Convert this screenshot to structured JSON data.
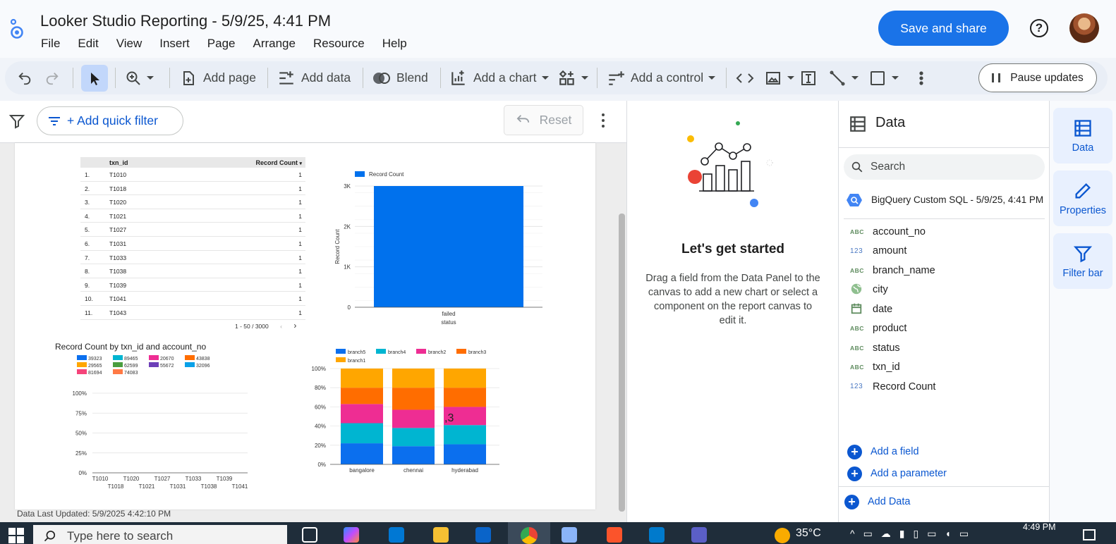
{
  "header": {
    "title": "Looker Studio Reporting - 5/9/25, 4:41 PM",
    "menu": [
      "File",
      "Edit",
      "View",
      "Insert",
      "Page",
      "Arrange",
      "Resource",
      "Help"
    ],
    "save_share": "Save and share",
    "help": "?"
  },
  "toolbar": {
    "add_page": "Add page",
    "add_data": "Add data",
    "blend": "Blend",
    "add_chart": "Add a chart",
    "add_control": "Add a control",
    "pause_updates": "Pause updates"
  },
  "filterbar": {
    "add_quick_filter": "+ Add quick filter",
    "reset": "Reset"
  },
  "canvas": {
    "data_last_updated": "Data Last Updated: 5/9/2025 4:42:10 PM",
    "table": {
      "columns": [
        "txn_id",
        "Record Count"
      ],
      "rows": [
        [
          "1.",
          "T1010",
          "1"
        ],
        [
          "2.",
          "T1018",
          "1"
        ],
        [
          "3.",
          "T1020",
          "1"
        ],
        [
          "4.",
          "T1021",
          "1"
        ],
        [
          "5.",
          "T1027",
          "1"
        ],
        [
          "6.",
          "T1031",
          "1"
        ],
        [
          "7.",
          "T1033",
          "1"
        ],
        [
          "8.",
          "T1038",
          "1"
        ],
        [
          "9.",
          "T1039",
          "1"
        ],
        [
          "10.",
          "T1041",
          "1"
        ],
        [
          "11.",
          "T1043",
          "1"
        ]
      ],
      "pagination": "1 - 50 / 3000"
    }
  },
  "chart_data": [
    {
      "type": "bar",
      "legend": [
        "Record Count"
      ],
      "categories": [
        "failed"
      ],
      "values": [
        3000
      ],
      "xlabel": "status",
      "ylabel": "Record Count",
      "yticks": [
        "0",
        "1K",
        "2K",
        "3K"
      ],
      "ylim": [
        0,
        3000
      ],
      "colors": [
        "#0071ed"
      ]
    },
    {
      "type": "bar",
      "title": "Record Count by txn_id and account_no",
      "legend": [
        "39323",
        "89465",
        "20670",
        "43838",
        "29565",
        "62599",
        "55672",
        "32096",
        "81694",
        "74083"
      ],
      "legend_colors": [
        "#0b6fee",
        "#00b5d1",
        "#ee2d93",
        "#ff6d00",
        "#ffa600",
        "#4a9e3f",
        "#6d3fb8",
        "#0aa1e8",
        "#f5447a",
        "#ff7a45"
      ],
      "categories_top": [
        "T1010",
        "T1020",
        "T1027",
        "T1033",
        "T1039"
      ],
      "categories_bottom": [
        "T1018",
        "T1021",
        "T1031",
        "T1038",
        "T1041"
      ],
      "yticks": [
        "0%",
        "25%",
        "50%",
        "75%",
        "100%"
      ]
    },
    {
      "type": "bar",
      "stacked": true,
      "percent": true,
      "categories": [
        "bangalore",
        "chennai",
        "hyderabad"
      ],
      "series": [
        {
          "name": "branch5",
          "values": [
            22,
            19,
            21
          ],
          "color": "#0b6fee"
        },
        {
          "name": "branch4",
          "values": [
            21,
            19,
            20
          ],
          "color": "#00b5d1"
        },
        {
          "name": "branch2",
          "values": [
            20,
            19,
            19
          ],
          "color": "#ee2d93"
        },
        {
          "name": "branch3",
          "values": [
            17,
            23,
            20
          ],
          "color": "#ff6d00"
        },
        {
          "name": "branch1",
          "values": [
            20,
            20,
            20
          ],
          "color": "#ffa600"
        }
      ],
      "yticks": [
        "0%",
        "20%",
        "40%",
        "60%",
        "80%",
        "100%"
      ],
      "overlay_label": ",3"
    }
  ],
  "get_started": {
    "title": "Let's get started",
    "description": "Drag a field from the Data Panel to the canvas to add a new chart or select a component on the report canvas to edit it."
  },
  "data_panel": {
    "title": "Data",
    "search_placeholder": "Search",
    "source": "BigQuery Custom SQL - 5/9/25, 4:41 PM",
    "fields": [
      {
        "type": "ABC",
        "name": "account_no"
      },
      {
        "type": "123",
        "name": "amount"
      },
      {
        "type": "ABC",
        "name": "branch_name"
      },
      {
        "type": "geo",
        "name": "city"
      },
      {
        "type": "date",
        "name": "date"
      },
      {
        "type": "ABC",
        "name": "product"
      },
      {
        "type": "ABC",
        "name": "status"
      },
      {
        "type": "ABC",
        "name": "txn_id"
      },
      {
        "type": "123",
        "name": "Record Count"
      }
    ],
    "add_field": "Add a field",
    "add_parameter": "Add a parameter",
    "add_data": "Add Data"
  },
  "rail": {
    "data": "Data",
    "properties": "Properties",
    "filter_bar": "Filter bar"
  },
  "taskbar": {
    "search_placeholder": "Type here to search",
    "weather": "35°C",
    "time": "4:49 PM"
  }
}
